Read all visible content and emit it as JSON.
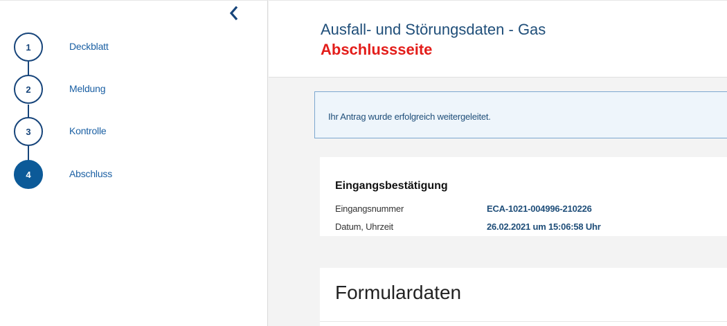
{
  "sidebar": {
    "collapse_icon": "chevron-left-icon",
    "steps": [
      {
        "number": "1",
        "label": "Deckblatt",
        "active": false
      },
      {
        "number": "2",
        "label": "Meldung",
        "active": false
      },
      {
        "number": "3",
        "label": "Kontrolle",
        "active": false
      },
      {
        "number": "4",
        "label": "Abschluss",
        "active": true
      }
    ]
  },
  "header": {
    "title": "Ausfall- und Störungsdaten - Gas",
    "subtitle": "Abschlussseite"
  },
  "banner": {
    "message": "Ihr Antrag wurde erfolgreich weitergeleitet."
  },
  "confirmation": {
    "title": "Eingangsbestätigung",
    "rows": [
      {
        "key": "Eingangsnummer",
        "value": "ECA-1021-004996-210226"
      },
      {
        "key": "Datum, Uhrzeit",
        "value": "26.02.2021 um 15:06:58 Uhr"
      }
    ]
  },
  "form_data": {
    "title": "Formulardaten"
  },
  "colors": {
    "accent": "#1f4e79",
    "step_active": "#0c5a98",
    "subtitle_red": "#e31d1a",
    "banner_bg": "#eef5fb",
    "banner_border": "#7ba7cf"
  }
}
